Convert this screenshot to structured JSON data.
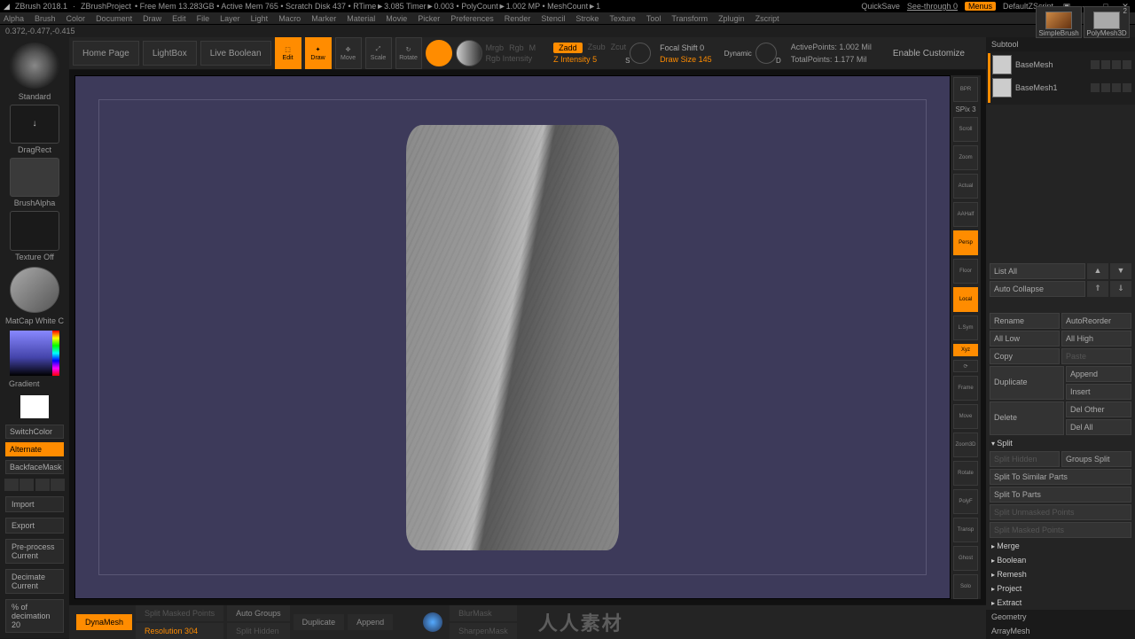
{
  "title": {
    "app": "ZBrush 2018.1",
    "project": "ZBrushProject",
    "stats": "• Free Mem 13.283GB • Active Mem 765 • Scratch Disk 437 • RTime►3.085 Timer►0.003 • PolyCount►1.002 MP • MeshCount►1",
    "quicksave": "QuickSave",
    "seethrough": "See-through  0",
    "menus": "Menus",
    "zscript": "DefaultZScript"
  },
  "menu": [
    "Alpha",
    "Brush",
    "Color",
    "Document",
    "Draw",
    "Edit",
    "File",
    "Layer",
    "Light",
    "Macro",
    "Marker",
    "Material",
    "Movie",
    "Picker",
    "Preferences",
    "Render",
    "Stencil",
    "Stroke",
    "Texture",
    "Tool",
    "Transform",
    "Zplugin",
    "Zscript"
  ],
  "menu_right": {
    "simple": "SimpleBrush",
    "poly": "PolyMesh3D",
    "count": "2",
    "base": "BaseMesh",
    "base1": "BaseMesh1"
  },
  "coords": "0.372,-0.477,-0.415",
  "toolbar": {
    "home": "Home Page",
    "lightbox": "LightBox",
    "liveboolean": "Live Boolean",
    "edit": "Edit",
    "draw": "Draw",
    "move": "Move",
    "scale": "Scale",
    "rotate": "Rotate",
    "mrgb": "Mrgb",
    "rgb": "Rgb",
    "m": "M",
    "rgb_intensity": "Rgb Intensity",
    "zadd": "Zadd",
    "zsub": "Zsub",
    "zcut": "Zcut",
    "zintensity": "Z Intensity 5",
    "focal": "Focal Shift 0",
    "drawsize": "Draw Size 145",
    "dynamic": "Dynamic",
    "active_pts": "ActivePoints: 1.002 Mil",
    "total_pts": "TotalPoints: 1.177 Mil",
    "enable_custom": "Enable Customize"
  },
  "left": {
    "standard": "Standard",
    "dragrect": "DragRect",
    "brushalpha": "BrushAlpha",
    "texture_off": "Texture Off",
    "matcap": "MatCap White C",
    "gradient": "Gradient",
    "switchcolor": "SwitchColor",
    "alternate": "Alternate",
    "backfacemask": "BackfaceMask",
    "import": "Import",
    "export": "Export",
    "preprocess": "Pre-process Current",
    "decimate": "Decimate Current",
    "pct": "% of decimation 20"
  },
  "righttools": [
    "BPR",
    "Scroll",
    "Zoom",
    "Actual",
    "AAHalf",
    "Persp",
    "Floor",
    "Local",
    "Xyz",
    "Frame",
    "Move",
    "Zoom3D",
    "Rotate",
    "PolyF",
    "Transp",
    "Ghost",
    "Solo"
  ],
  "righttools_spix": "SPix 3",
  "bottom": {
    "dynamesh": "DynaMesh",
    "splitmasked": "Split Masked Points",
    "splithidden": "Split Hidden",
    "resolution": "Resolution 304",
    "autogroups": "Auto Groups",
    "duplicate": "Duplicate",
    "append": "Append",
    "blurmask": "BlurMask",
    "sharpenmask": "SharpenMask",
    "watermark": "人人素材"
  },
  "right": {
    "subtool": "Subtool",
    "items": [
      {
        "name": "BaseMesh"
      },
      {
        "name": "BaseMesh1"
      }
    ],
    "listall": "List All",
    "autocollapse": "Auto Collapse",
    "rename": "Rename",
    "autoreorder": "AutoReorder",
    "alllow": "All Low",
    "allhigh": "All High",
    "copy": "Copy",
    "paste": "Paste",
    "duplicate": "Duplicate",
    "append": "Append",
    "insert": "Insert",
    "delete": "Delete",
    "delother": "Del Other",
    "delall": "Del All",
    "split": "Split",
    "splithidden": "Split Hidden",
    "groupssplit": "Groups Split",
    "splitsimilar": "Split To Similar Parts",
    "splitparts": "Split To Parts",
    "splitunmasked": "Split Unmasked Points",
    "splitmasked": "Split Masked Points",
    "merge": "Merge",
    "boolean": "Boolean",
    "remesh": "Remesh",
    "project": "Project",
    "extract": "Extract",
    "geometry": "Geometry",
    "arraymesh": "ArrayMesh"
  }
}
